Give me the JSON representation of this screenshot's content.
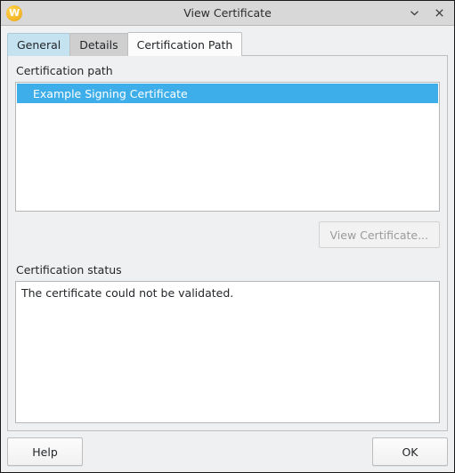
{
  "window": {
    "title": "View Certificate",
    "icon": "wine-glass-icon",
    "icon_letter": "W",
    "controls": [
      {
        "name": "minimize",
        "glyph": "chevron-down-icon"
      },
      {
        "name": "close",
        "glyph": "close-icon"
      }
    ]
  },
  "tabs": [
    {
      "id": "general",
      "label": "General",
      "state": "hovered"
    },
    {
      "id": "details",
      "label": "Details",
      "state": "normal"
    },
    {
      "id": "certification-path",
      "label": "Certification Path",
      "state": "active"
    }
  ],
  "certification_path": {
    "group_label": "Certification path",
    "items": [
      {
        "label": "Example Signing Certificate",
        "selected": true
      }
    ],
    "view_certificate_button": {
      "label": "View Certificate...",
      "enabled": false
    }
  },
  "certification_status": {
    "group_label": "Certification status",
    "text": "The certificate could not be validated."
  },
  "footer": {
    "help_label": "Help",
    "ok_label": "OK"
  },
  "colors": {
    "selection": "#3daee9",
    "titlebar": "#d8d8d8",
    "window_background": "#eff0f1",
    "tab_hover": "#c5e2f0",
    "field_background": "#ffffff"
  }
}
